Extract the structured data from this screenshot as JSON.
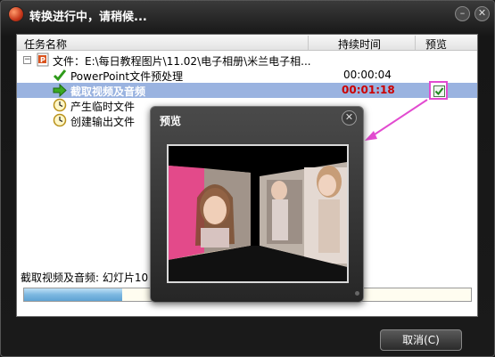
{
  "window": {
    "title": "转换进行中，请稍候..."
  },
  "columns": {
    "name": "任务名称",
    "duration": "持续时间",
    "preview": "预览"
  },
  "tree": {
    "root": {
      "label": "文件：E:\\每日教程图片\\11.02\\电子相册\\米兰电子相..."
    },
    "tasks": [
      {
        "label": "PowerPoint文件预处理",
        "duration": "00:00:04",
        "state": "done",
        "icon": "check-icon"
      },
      {
        "label": "截取视频及音频",
        "duration": "00:01:18",
        "state": "active",
        "icon": "arrow-right-icon"
      },
      {
        "label": "产生临时文件",
        "duration": "",
        "state": "pending",
        "icon": "clock-icon"
      },
      {
        "label": "创建输出文件",
        "duration": "",
        "state": "pending",
        "icon": "clock-icon"
      }
    ]
  },
  "status": {
    "text": "截取视频及音频: 幻灯片10"
  },
  "progress": {
    "fraction": 0.22
  },
  "buttons": {
    "cancel": "取消(C)"
  },
  "preview_dialog": {
    "title": "预览"
  },
  "colors": {
    "active_duration": "#cc0000",
    "highlight": "#e24bd0",
    "selected_row": "#9ab3e0"
  }
}
